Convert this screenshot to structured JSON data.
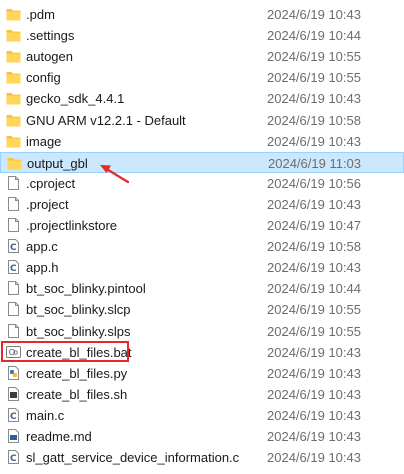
{
  "file_list": {
    "items": [
      {
        "name": ".pdm",
        "modified": "2024/6/19 10:43",
        "icon": "folder-icon"
      },
      {
        "name": ".settings",
        "modified": "2024/6/19 10:44",
        "icon": "folder-icon"
      },
      {
        "name": "autogen",
        "modified": "2024/6/19 10:55",
        "icon": "folder-icon"
      },
      {
        "name": "config",
        "modified": "2024/6/19 10:55",
        "icon": "folder-icon"
      },
      {
        "name": "gecko_sdk_4.4.1",
        "modified": "2024/6/19 10:43",
        "icon": "folder-icon"
      },
      {
        "name": "GNU ARM v12.2.1 - Default",
        "modified": "2024/6/19 10:58",
        "icon": "folder-icon"
      },
      {
        "name": "image",
        "modified": "2024/6/19 10:43",
        "icon": "folder-icon"
      },
      {
        "name": "output_gbl",
        "modified": "2024/6/19 11:03",
        "icon": "folder-icon"
      },
      {
        "name": ".cproject",
        "modified": "2024/6/19 10:56",
        "icon": "file-icon"
      },
      {
        "name": ".project",
        "modified": "2024/6/19 10:43",
        "icon": "file-icon"
      },
      {
        "name": ".projectlinkstore",
        "modified": "2024/6/19 10:47",
        "icon": "file-icon"
      },
      {
        "name": "app.c",
        "modified": "2024/6/19 10:58",
        "icon": "c-source-file-icon"
      },
      {
        "name": "app.h",
        "modified": "2024/6/19 10:43",
        "icon": "c-source-file-icon"
      },
      {
        "name": "bt_soc_blinky.pintool",
        "modified": "2024/6/19 10:44",
        "icon": "file-icon"
      },
      {
        "name": "bt_soc_blinky.slcp",
        "modified": "2024/6/19 10:55",
        "icon": "file-icon"
      },
      {
        "name": "bt_soc_blinky.slps",
        "modified": "2024/6/19 10:55",
        "icon": "file-icon"
      },
      {
        "name": "create_bl_files.bat",
        "modified": "2024/6/19 10:43",
        "icon": "batch-file-icon"
      },
      {
        "name": "create_bl_files.py",
        "modified": "2024/6/19 10:43",
        "icon": "python-file-icon"
      },
      {
        "name": "create_bl_files.sh",
        "modified": "2024/6/19 10:43",
        "icon": "shell-script-icon"
      },
      {
        "name": "main.c",
        "modified": "2024/6/19 10:43",
        "icon": "c-source-file-icon"
      },
      {
        "name": "readme.md",
        "modified": "2024/6/19 10:43",
        "icon": "markdown-file-icon"
      },
      {
        "name": "sl_gatt_service_device_information.c",
        "modified": "2024/6/19 10:43",
        "icon": "c-source-file-icon"
      }
    ],
    "selected_index": 7,
    "annotated_index": 16
  },
  "colors": {
    "selection_bg": "#cce8ff",
    "selection_border": "#99d1ff",
    "folder": "#f5c342",
    "annotation": "#e8272a"
  }
}
